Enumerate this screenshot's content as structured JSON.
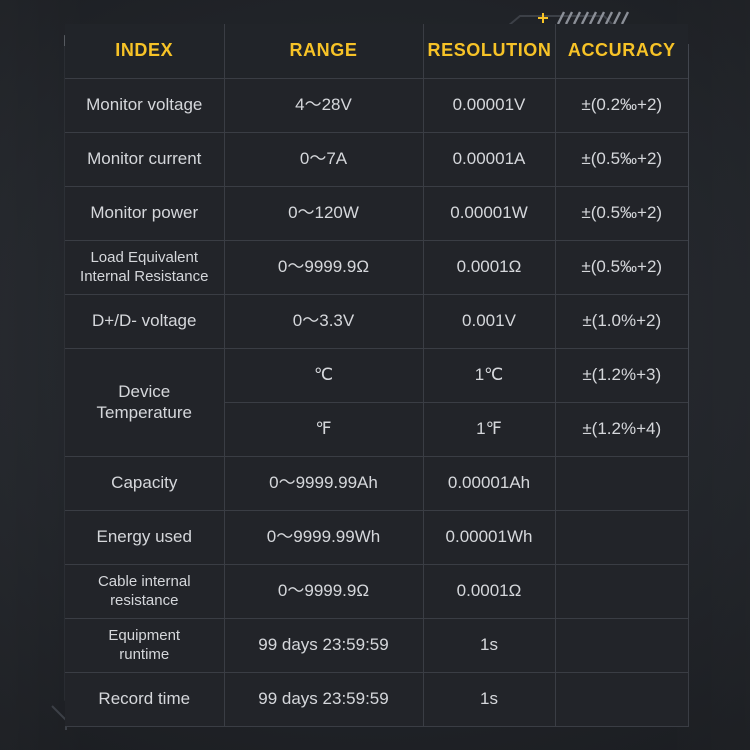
{
  "panel": {
    "accent_color": "#f7c327",
    "grid_color": "#3a3d44",
    "text_color": "#d5d7db",
    "background_color": "#222429"
  },
  "decor": {
    "plus_marker": "+",
    "hatch_count": 9
  },
  "table": {
    "headers": [
      "INDEX",
      "RANGE",
      "RESOLUTION",
      "ACCURACY"
    ],
    "rows": [
      {
        "index": "Monitor voltage",
        "range": "4～28V",
        "resolution": "0.00001V",
        "accuracy": "±(0.2‰+2)"
      },
      {
        "index": "Monitor current",
        "range": "0～7A",
        "resolution": "0.00001A",
        "accuracy": "±(0.5‰+2)"
      },
      {
        "index": "Monitor power",
        "range": "0～120W",
        "resolution": "0.00001W",
        "accuracy": "±(0.5‰+2)"
      },
      {
        "index": "Load Equivalent Internal Resistance",
        "index_line1": "Load Equivalent",
        "index_line2": "Internal Resistance",
        "range": "0～9999.9Ω",
        "resolution": "0.0001Ω",
        "accuracy": "±(0.5‰+2)"
      },
      {
        "index": "D+/D- voltage",
        "range": "0～3.3V",
        "resolution": "0.001V",
        "accuracy": "±(1.0%+2)"
      },
      {
        "index": "Device Temperature",
        "index_line1": "Device",
        "index_line2": "Temperature",
        "rowspan": 2,
        "range": "℃",
        "resolution": "1℃",
        "accuracy": "±(1.2%+3)"
      },
      {
        "range": "℉",
        "resolution": "1℉",
        "accuracy": "±(1.2%+4)"
      },
      {
        "index": "Capacity",
        "range": "0～9999.99Ah",
        "resolution": "0.00001Ah",
        "accuracy": ""
      },
      {
        "index": "Energy used",
        "range": "0～9999.99Wh",
        "resolution": "0.00001Wh",
        "accuracy": ""
      },
      {
        "index": "Cable internal resistance",
        "index_line1": "Cable internal",
        "index_line2": "resistance",
        "range": "0～9999.9Ω",
        "resolution": "0.0001Ω",
        "accuracy": ""
      },
      {
        "index": "Equipment runtime",
        "index_line1": "Equipment",
        "index_line2": "runtime",
        "range": "99 days 23:59:59",
        "resolution": "1s",
        "accuracy": ""
      },
      {
        "index": "Record time",
        "range": "99 days 23:59:59",
        "resolution": "1s",
        "accuracy": ""
      }
    ]
  }
}
